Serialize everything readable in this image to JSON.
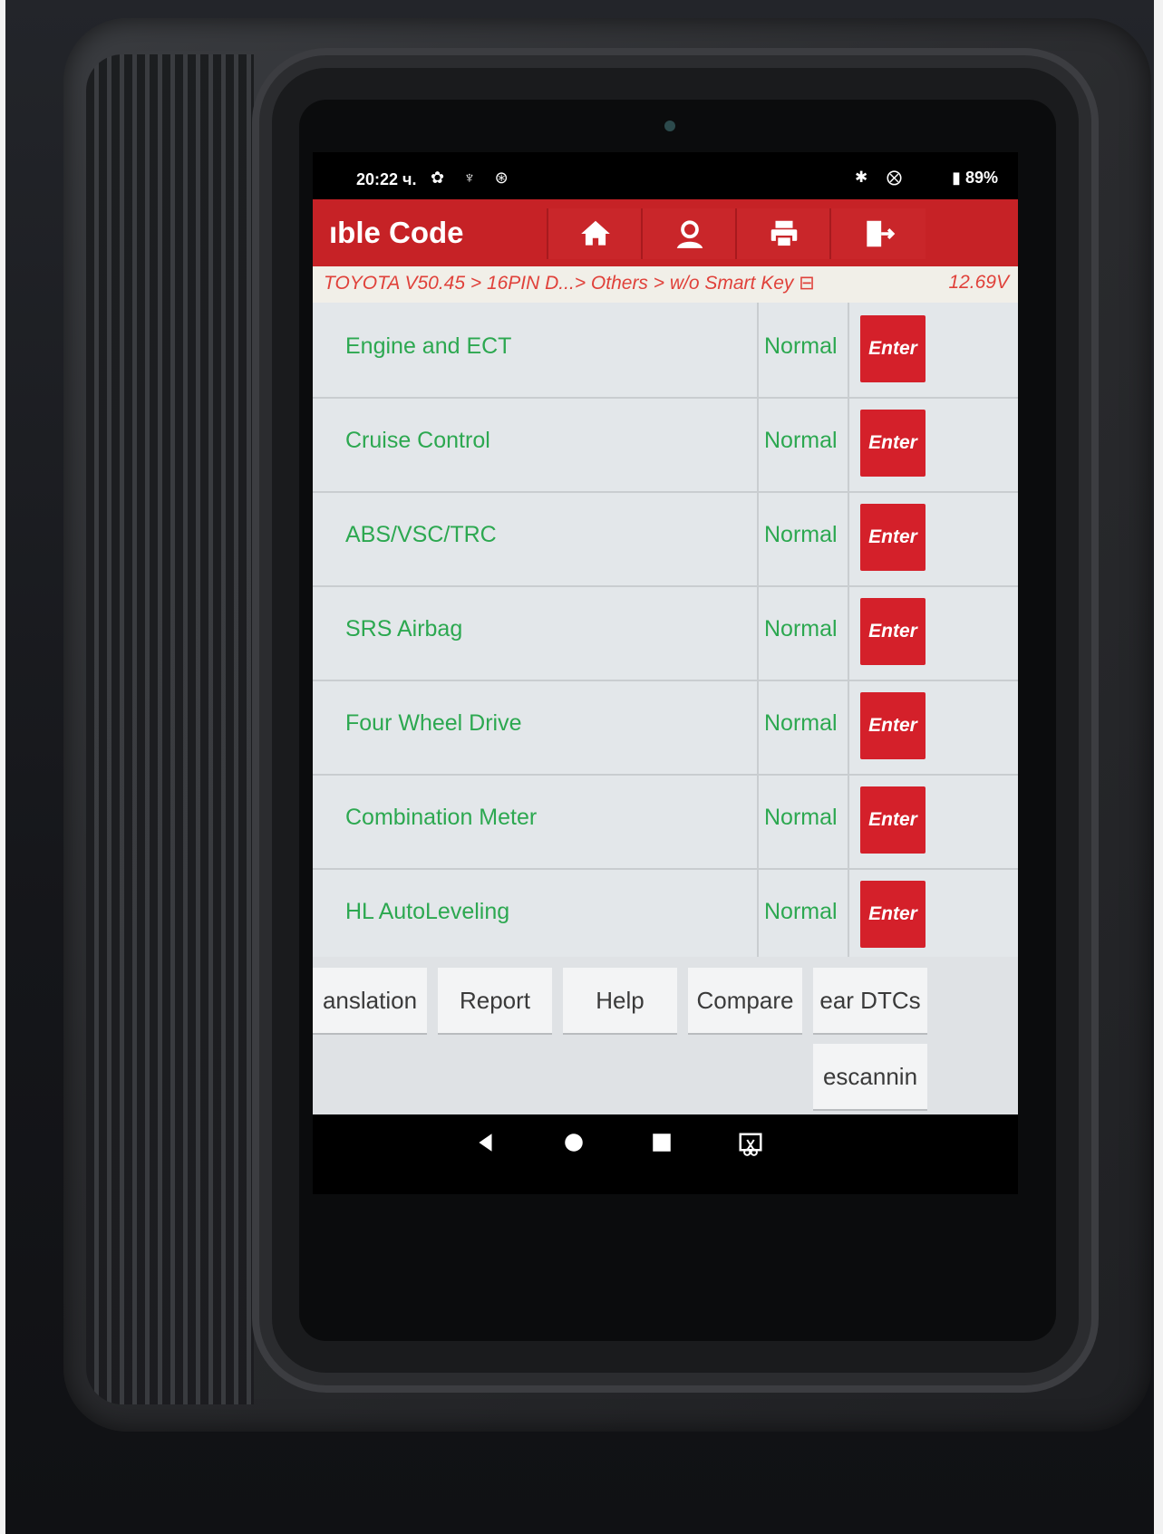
{
  "status_bar": {
    "time": "20:22 ч.",
    "left_icons": "✿ ♆ ⊛",
    "right_icons": "✱ ⨂",
    "battery": "89%"
  },
  "header": {
    "title": "ıble Code",
    "buttons": [
      "home-icon",
      "user-icon",
      "printer-icon",
      "exit-icon"
    ]
  },
  "breadcrumb": {
    "path": "TOYOTA V50.45 > 16PIN D...> Others > w/o Smart Key",
    "voltage": "12.69V"
  },
  "systems": [
    {
      "name": "Engine and ECT",
      "status": "Normal",
      "action": "Enter"
    },
    {
      "name": "Cruise Control",
      "status": "Normal",
      "action": "Enter"
    },
    {
      "name": "ABS/VSC/TRC",
      "status": "Normal",
      "action": "Enter"
    },
    {
      "name": "SRS Airbag",
      "status": "Normal",
      "action": "Enter"
    },
    {
      "name": "Four Wheel Drive",
      "status": "Normal",
      "action": "Enter"
    },
    {
      "name": "Combination Meter",
      "status": "Normal",
      "action": "Enter"
    },
    {
      "name": "HL AutoLeveling",
      "status": "Normal",
      "action": "Enter"
    }
  ],
  "toolbar": {
    "translation": "anslation",
    "report": "Report",
    "help": "Help",
    "compare": "Compare",
    "clear_dtcs": "ear DTCs",
    "rescanning": "escannin"
  },
  "colors": {
    "header_red": "#c62226",
    "status_green": "#2ca850",
    "breadcrumb_red": "#e0413a"
  }
}
